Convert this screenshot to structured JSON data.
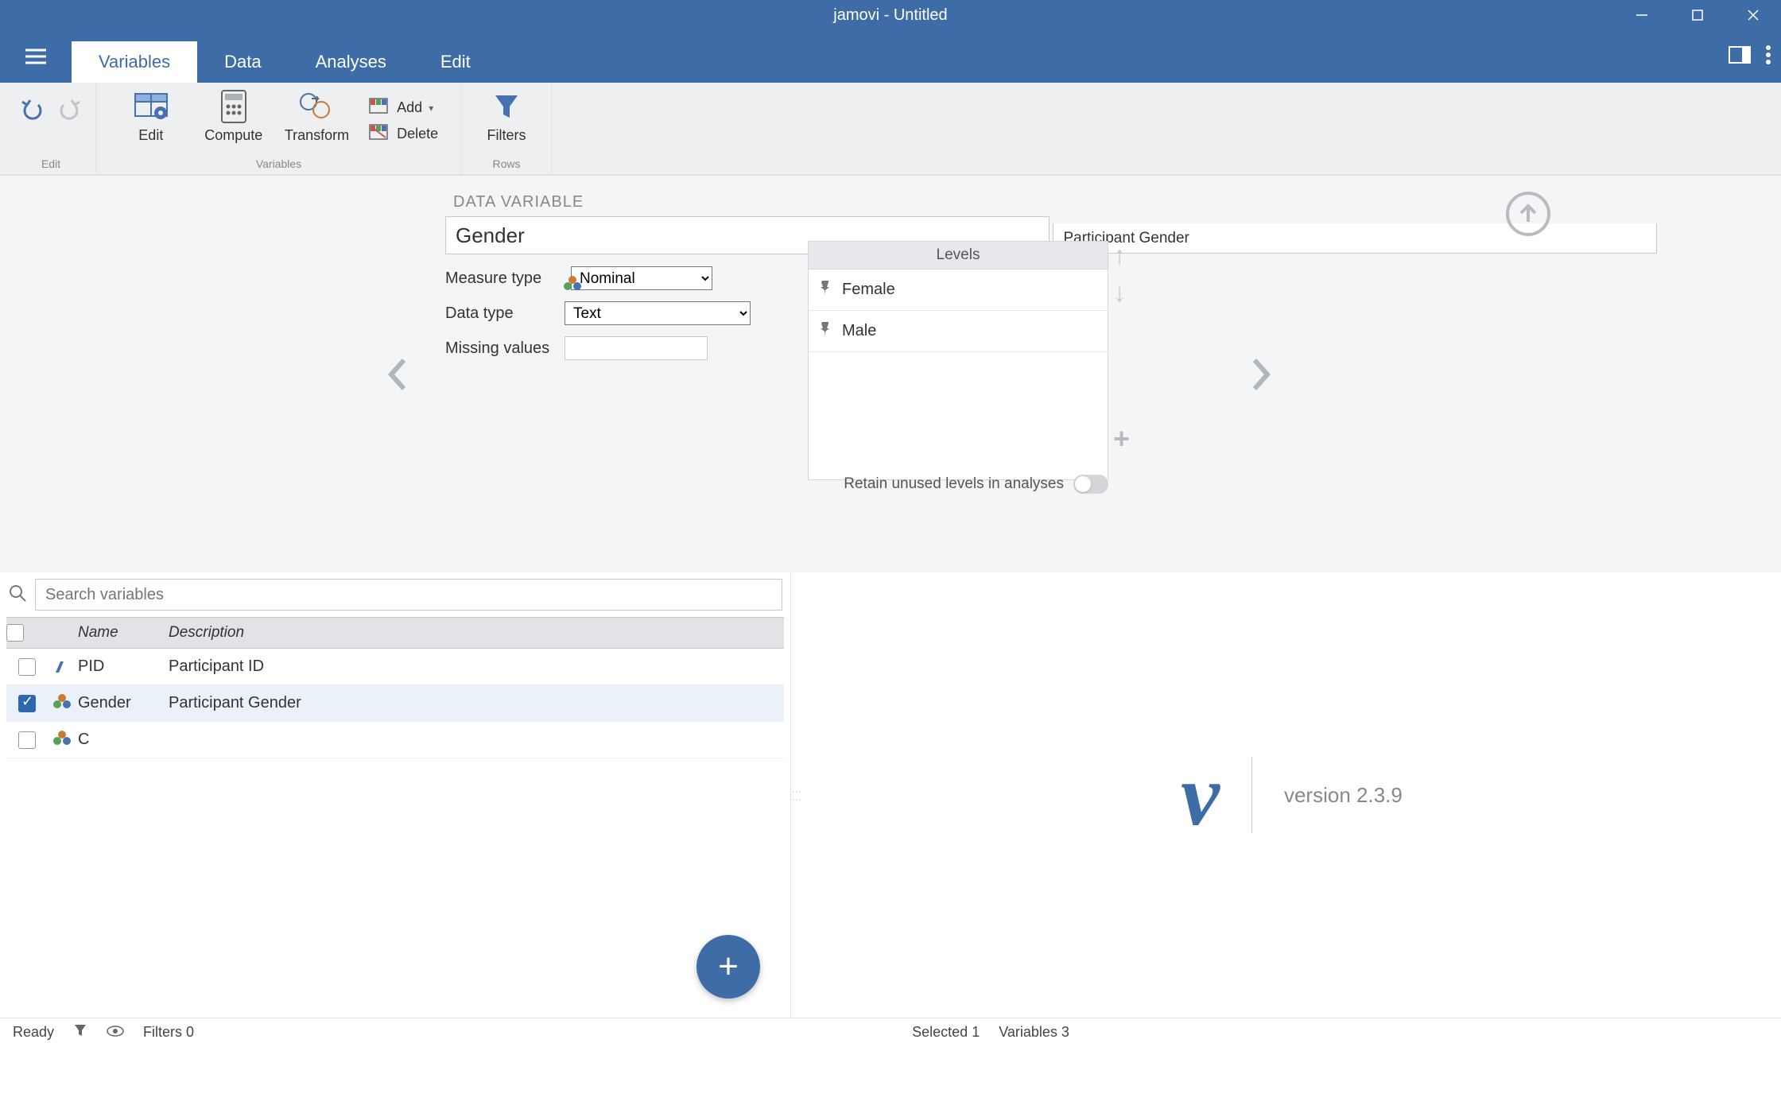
{
  "titlebar": {
    "title": "jamovi - Untitled"
  },
  "tabs": {
    "variables": "Variables",
    "data": "Data",
    "analyses": "Analyses",
    "edit": "Edit"
  },
  "ribbon": {
    "undo_group_label": "Edit",
    "edit": "Edit",
    "compute": "Compute",
    "transform": "Transform",
    "add": "Add",
    "delete": "Delete",
    "variables_group_label": "Variables",
    "filters": "Filters",
    "rows_group_label": "Rows"
  },
  "editor": {
    "header": "DATA VARIABLE",
    "name": "Gender",
    "description": "Participant Gender",
    "measure_type_label": "Measure type",
    "measure_type_value": "Nominal",
    "data_type_label": "Data type",
    "data_type_value": "Text",
    "missing_label": "Missing values",
    "levels_header": "Levels",
    "levels": [
      "Female",
      "Male"
    ],
    "retain_label": "Retain unused levels in analyses"
  },
  "search": {
    "placeholder": "Search variables"
  },
  "columns": {
    "name": "Name",
    "description": "Description"
  },
  "rows": [
    {
      "checked": false,
      "icon": "id",
      "name": "PID",
      "desc": "Participant ID"
    },
    {
      "checked": true,
      "icon": "nominal",
      "name": "Gender",
      "desc": "Participant Gender"
    },
    {
      "checked": false,
      "icon": "nominal",
      "name": "C",
      "desc": ""
    }
  ],
  "results": {
    "version_label": "version 2.3.9"
  },
  "status": {
    "ready": "Ready",
    "filters": "Filters 0",
    "selected": "Selected 1",
    "variables": "Variables 3"
  }
}
